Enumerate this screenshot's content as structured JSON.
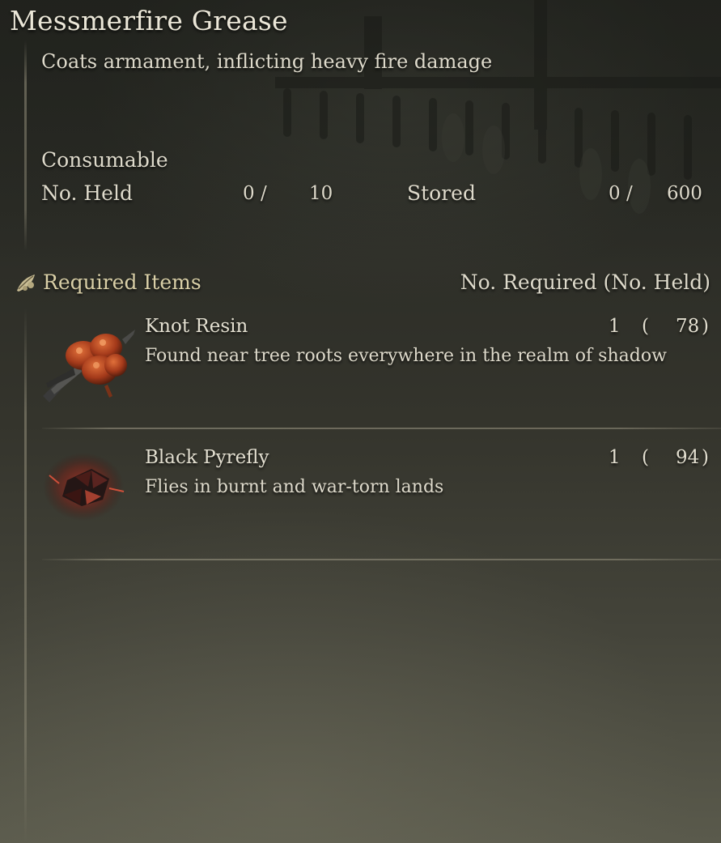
{
  "item": {
    "name": "Messmerfire Grease",
    "description": "Coats armament, inflicting heavy fire damage",
    "category": "Consumable",
    "held_label": "No. Held",
    "held_value": "0 /",
    "held_max": "10",
    "stored_label": "Stored",
    "stored_value": "0 /",
    "stored_max": "600"
  },
  "required": {
    "header": "Required Items",
    "header_right": "No. Required (No. Held)",
    "icon": "crafting-material-icon",
    "items": [
      {
        "name": "Knot Resin",
        "description": "Found near tree roots everywhere in the realm of shadow",
        "required": "1",
        "open_paren": "(",
        "held": "78",
        "close_paren": ")",
        "icon": "knot-resin-icon"
      },
      {
        "name": "Black Pyrefly",
        "description": "Flies in burnt and war-torn lands",
        "required": "1",
        "open_paren": "(",
        "held": "94",
        "close_paren": ")",
        "icon": "black-pyrefly-icon"
      }
    ]
  },
  "colors": {
    "header_accent": "#d9cfa7",
    "text": "#dedacb"
  }
}
